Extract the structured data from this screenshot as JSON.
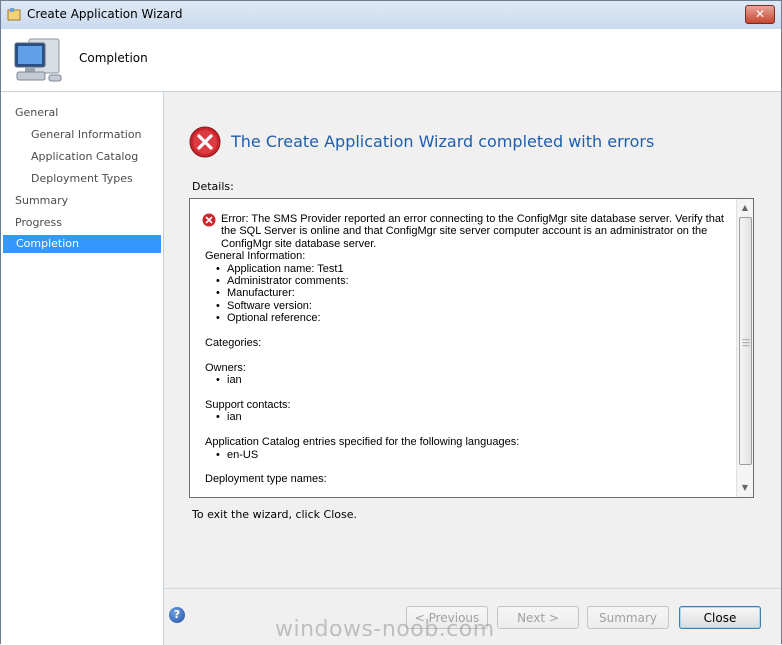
{
  "window": {
    "title": "Create Application Wizard",
    "close_glyph": "✕"
  },
  "header": {
    "heading": "Completion",
    "icon": "computer-icon"
  },
  "sidebar": {
    "items": [
      {
        "label": "General",
        "indent": 0,
        "selected": false
      },
      {
        "label": "General Information",
        "indent": 1,
        "selected": false
      },
      {
        "label": "Application Catalog",
        "indent": 1,
        "selected": false
      },
      {
        "label": "Deployment Types",
        "indent": 1,
        "selected": false
      },
      {
        "label": "Summary",
        "indent": 0,
        "selected": false
      },
      {
        "label": "Progress",
        "indent": 0,
        "selected": false
      },
      {
        "label": "Completion",
        "indent": 0,
        "selected": true
      }
    ]
  },
  "status": {
    "title": "The Create Application Wizard completed with errors",
    "icon": "error-icon",
    "title_color": "#1e5fad"
  },
  "details": {
    "label": "Details:",
    "error_text": "Error: The SMS Provider reported an error connecting to the ConfigMgr site database server. Verify that the SQL Server is online and that ConfigMgr site server computer account is an administrator on the ConfigMgr site database server.",
    "general_heading": "General Information:",
    "general_items": [
      "Application name: Test1",
      "Administrator comments:",
      "Manufacturer:",
      "Software version:",
      "Optional reference:"
    ],
    "categories_heading": "Categories:",
    "owners_heading": "Owners:",
    "owners": [
      "ian"
    ],
    "support_heading": "Support contacts:",
    "support": [
      "ian"
    ],
    "catalog_heading": "Application Catalog entries specified for the following languages:",
    "languages": [
      "en-US"
    ],
    "deployment_heading": "Deployment type names:"
  },
  "exit_text": "To exit the wizard, click Close.",
  "buttons": {
    "previous": "< Previous",
    "next": "Next >",
    "summary": "Summary",
    "close": "Close",
    "help": "?"
  },
  "watermark": "windows-noob.com"
}
